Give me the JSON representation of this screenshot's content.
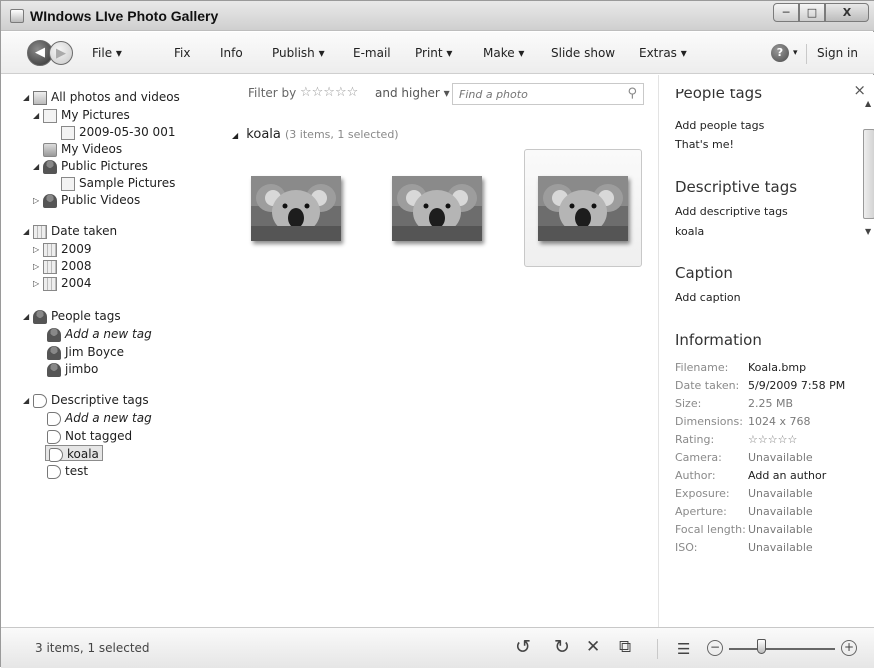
{
  "window": {
    "title": "WIndows LIve Photo Gallery",
    "minimize": "─",
    "maximize": "□",
    "close": "X"
  },
  "toolbar": {
    "back": "◀",
    "forward": "▶",
    "menus": [
      "File ▾",
      "Fix",
      "Info",
      "Publish ▾",
      "E-mail",
      "Print ▾",
      "Make ▾",
      "Slide show",
      "Extras ▾"
    ],
    "help": "?",
    "help_arrow": "▾",
    "sign_in": "Sign in"
  },
  "navigation": {
    "all_photos": "All photos and videos",
    "my_pictures": "My Pictures",
    "folder_2009": "2009-05-30 001",
    "my_videos": "My Videos",
    "public_pictures": "Public Pictures",
    "sample_pictures": "Sample Pictures",
    "public_videos": "Public Videos",
    "date_taken": "Date taken",
    "years": [
      "2009",
      "2008",
      "2004"
    ],
    "people_tags": "People tags",
    "people_add": "Add a new tag",
    "people": [
      "Jim Boyce",
      "jimbo"
    ],
    "descriptive_tags": "Descriptive tags",
    "desc_add": "Add a new tag",
    "not_tagged": "Not tagged",
    "tag_koala": "koala",
    "tag_test": "test"
  },
  "filter": {
    "label": "Filter by",
    "stars": "☆☆☆☆☆",
    "and_higher": "and higher ▾",
    "search_placeholder": "Find a photo",
    "search_icon": "⚲"
  },
  "group": {
    "arrow": "◢",
    "name": "koala",
    "meta": "(3 items, 1 selected)"
  },
  "details": {
    "close": "×",
    "people_header": "People tags",
    "add_people": "Add people tags",
    "thats_me": "That's me!",
    "descriptive_header": "Descriptive tags",
    "add_descriptive": "Add descriptive tags",
    "desc_value": "koala",
    "caption_header": "Caption",
    "add_caption": "Add caption",
    "info_header": "Information",
    "info": [
      {
        "k": "Filename:",
        "v": "Koala.bmp",
        "dark": true
      },
      {
        "k": "Date taken:",
        "v": "5/9/2009 7:58 PM",
        "dark": true
      },
      {
        "k": "Size:",
        "v": "2.25 MB",
        "dark": false
      },
      {
        "k": "Dimensions:",
        "v": "1024 x 768",
        "dark": false
      },
      {
        "k": "Rating:",
        "v": "☆☆☆☆☆",
        "dark": false
      },
      {
        "k": "Camera:",
        "v": "Unavailable",
        "dark": false
      },
      {
        "k": "Author:",
        "v": "Add an author",
        "dark": true
      },
      {
        "k": "Exposure:",
        "v": "Unavailable",
        "dark": false
      },
      {
        "k": "Aperture:",
        "v": "Unavailable",
        "dark": false
      },
      {
        "k": "Focal length:",
        "v": "Unavailable",
        "dark": false
      },
      {
        "k": "ISO:",
        "v": "Unavailable",
        "dark": false
      }
    ]
  },
  "status": {
    "text": "3 items, 1 selected",
    "icons": {
      "rotate_left": "↺",
      "rotate_right": "↻",
      "delete": "✕",
      "slideshow": "⧉",
      "view": "☰"
    },
    "zoom_minus": "−",
    "zoom_plus": "+",
    "zoom_level": 0.3
  }
}
